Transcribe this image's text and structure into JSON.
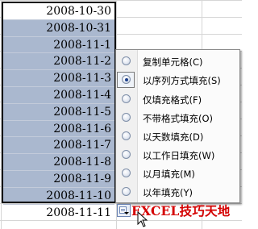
{
  "cells": [
    "2008-10-30",
    "2008-10-31",
    "2008-11-1",
    "2008-11-2",
    "2008-11-3",
    "2008-11-4",
    "2008-11-5",
    "2008-11-6",
    "2008-11-7",
    "2008-11-8",
    "2008-11-9",
    "2008-11-10",
    "2008-11-11"
  ],
  "menu": {
    "items": [
      {
        "label": "复制单元格(C)",
        "selected": false
      },
      {
        "label": "以序列方式填充(S)",
        "selected": true
      },
      {
        "label": "仅填充格式(F)",
        "selected": false
      },
      {
        "label": "不带格式填充(O)",
        "selected": false
      },
      {
        "label": "以天数填充(D)",
        "selected": false
      },
      {
        "label": "以工作日填充(W)",
        "selected": false
      },
      {
        "label": "以月填充(M)",
        "selected": false
      },
      {
        "label": "以年填充(Y)",
        "selected": false
      }
    ]
  },
  "watermark": "EXCEL技巧天地",
  "fill_button_icon": "auto-fill-options-icon",
  "cursor_icon": "arrow-cursor-icon",
  "colors": {
    "selection": "#aab8cf",
    "watermark": "#d40000"
  }
}
